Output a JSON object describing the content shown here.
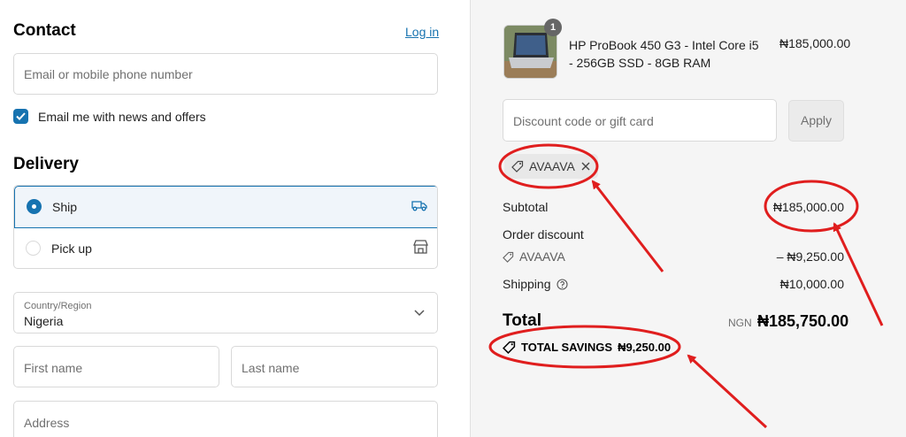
{
  "contact": {
    "title": "Contact",
    "login_link": "Log in",
    "email_placeholder": "Email or mobile phone number",
    "newsletter_label": "Email me with news and offers",
    "newsletter_checked": true
  },
  "delivery": {
    "title": "Delivery",
    "options": [
      {
        "label": "Ship",
        "selected": true,
        "icon": "truck-icon"
      },
      {
        "label": "Pick up",
        "selected": false,
        "icon": "store-icon"
      }
    ],
    "country_label": "Country/Region",
    "country_value": "Nigeria",
    "first_name_placeholder": "First name",
    "last_name_placeholder": "Last name",
    "address_placeholder": "Address"
  },
  "summary": {
    "item": {
      "quantity": "1",
      "name": "HP ProBook 450 G3 - Intel Core i5 - 256GB SSD - 8GB RAM",
      "price": "₦185,000.00"
    },
    "discount_placeholder": "Discount code or gift card",
    "apply_label": "Apply",
    "applied_code": "AVAAVA",
    "subtotal_label": "Subtotal",
    "subtotal_value": "₦185,000.00",
    "order_discount_label": "Order discount",
    "discount_code": "AVAAVA",
    "discount_value": "– ₦9,250.00",
    "shipping_label": "Shipping",
    "shipping_value": "₦10,000.00",
    "total_label": "Total",
    "currency": "NGN",
    "total_value": "₦185,750.00",
    "savings_label": "TOTAL SAVINGS",
    "savings_value": "₦9,250.00"
  },
  "colors": {
    "accent": "#1773b0",
    "annotation": "#e01e1e",
    "summary_bg": "#f5f5f5"
  }
}
